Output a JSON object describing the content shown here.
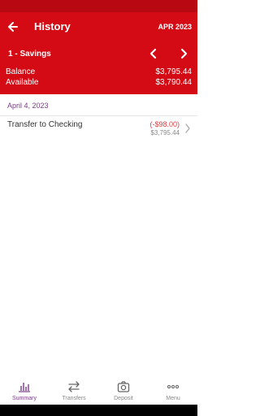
{
  "header": {
    "title": "History",
    "month": "APR 2023",
    "back_icon": "arrow-left-icon"
  },
  "account": {
    "name": "1 - Savings",
    "balance_label": "Balance",
    "balance_value": "$3,795.44",
    "available_label": "Available",
    "available_value": "$3,790.44"
  },
  "transactions": {
    "groups": [
      {
        "date": "April 4, 2023",
        "items": [
          {
            "description": "Transfer to Checking",
            "amount": "(-$98.00)",
            "running_balance": "$3,795.44"
          }
        ]
      }
    ]
  },
  "bottom_nav": [
    {
      "label": "Summary",
      "icon": "bar-chart-icon",
      "active": true
    },
    {
      "label": "Transfers",
      "icon": "transfer-arrows-icon",
      "active": false
    },
    {
      "label": "Deposit",
      "icon": "camera-icon",
      "active": false
    },
    {
      "label": "Menu",
      "icon": "more-dots-icon",
      "active": false
    }
  ],
  "colors": {
    "brand_red": "#d40a14",
    "status_bar": "#b80912",
    "accent_purple": "#7a3b8a",
    "negative_amount": "#e0383e"
  }
}
